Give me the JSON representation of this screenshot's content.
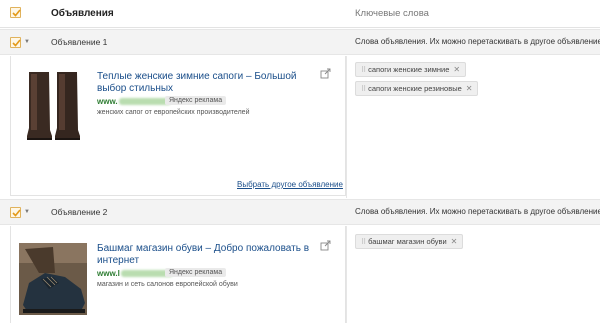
{
  "header": {
    "ads_label": "Объявления",
    "keywords_label": "Ключевые слова"
  },
  "groups": [
    {
      "title": "Объявление 1",
      "hint": "Слова объявления. Их можно перетаскивать в другое объявление",
      "ad": {
        "title": "Теплые женские зимние сапоги – Большой выбор стильных",
        "url_prefix": "www.",
        "label": "Яндекс реклама",
        "description": "женских сапог от европейских производителей",
        "image": "boots-photo"
      },
      "choose_other": "Выбрать другое объявление",
      "keywords": [
        "сапоги женские зимние",
        "сапоги женские резиновые"
      ]
    },
    {
      "title": "Объявление 2",
      "hint": "Слова объявления. Их можно перетаскивать в другое объявление",
      "ad": {
        "title": "Башмаг магазин обуви – Добро пожаловать в интернет",
        "url_prefix": "www.l",
        "label": "Яндекс реклама",
        "description": "магазин и сеть салонов европейской обуви",
        "image": "shoe-photo"
      },
      "keywords": [
        "башмаг магазин обуви"
      ]
    }
  ],
  "icons": {
    "checkbox": "checkmark-icon",
    "expand": "caret-down-icon",
    "external": "external-link-icon",
    "grip": "drag-grip-icon",
    "remove": "close-icon"
  },
  "colors": {
    "checkbox_border": "#e0b25c",
    "checkmark": "#e39a1a",
    "link": "#1a4e8a",
    "url": "#2e7d32",
    "group_bg": "#f3f3f3"
  }
}
